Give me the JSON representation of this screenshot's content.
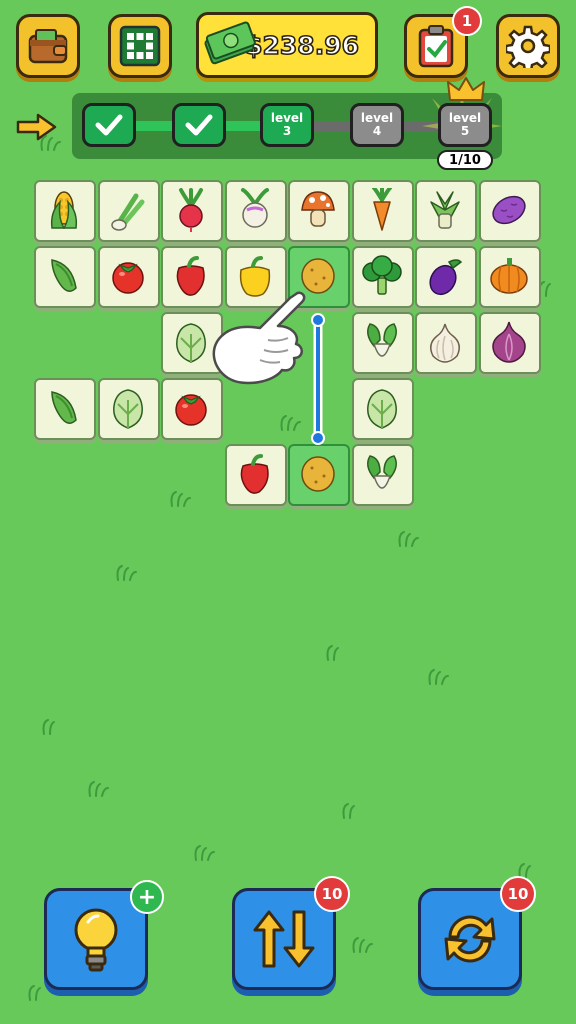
{
  "header": {
    "money": "$238.96",
    "task_badge": "1"
  },
  "progress": {
    "levels": [
      {
        "state": "done"
      },
      {
        "state": "done"
      },
      {
        "word": "level",
        "num": "3",
        "state": "current"
      },
      {
        "word": "level",
        "num": "4",
        "state": "locked"
      },
      {
        "word": "level",
        "num": "5",
        "state": "locked"
      }
    ],
    "counter": "1/10"
  },
  "board": {
    "tiles": [
      {
        "row": 0,
        "col": 0,
        "item": "corn"
      },
      {
        "row": 0,
        "col": 1,
        "item": "scallion"
      },
      {
        "row": 0,
        "col": 2,
        "item": "radish"
      },
      {
        "row": 0,
        "col": 3,
        "item": "turnip"
      },
      {
        "row": 0,
        "col": 4,
        "item": "mushroom"
      },
      {
        "row": 0,
        "col": 5,
        "item": "carrot"
      },
      {
        "row": 0,
        "col": 6,
        "item": "bamboo-shoot"
      },
      {
        "row": 0,
        "col": 7,
        "item": "sweet-potato"
      },
      {
        "row": 1,
        "col": 0,
        "item": "peas"
      },
      {
        "row": 1,
        "col": 1,
        "item": "tomato"
      },
      {
        "row": 1,
        "col": 2,
        "item": "red-pepper"
      },
      {
        "row": 1,
        "col": 3,
        "item": "yellow-pepper"
      },
      {
        "row": 1,
        "col": 4,
        "item": "potato",
        "selected": true
      },
      {
        "row": 1,
        "col": 5,
        "item": "broccoli"
      },
      {
        "row": 1,
        "col": 6,
        "item": "eggplant"
      },
      {
        "row": 1,
        "col": 7,
        "item": "pumpkin"
      },
      {
        "row": 2,
        "col": 2,
        "item": "cabbage"
      },
      {
        "row": 2,
        "col": 5,
        "item": "bok-choy"
      },
      {
        "row": 2,
        "col": 6,
        "item": "garlic"
      },
      {
        "row": 2,
        "col": 7,
        "item": "onion"
      },
      {
        "row": 3,
        "col": 0,
        "item": "peas"
      },
      {
        "row": 3,
        "col": 1,
        "item": "cabbage"
      },
      {
        "row": 3,
        "col": 2,
        "item": "tomato"
      },
      {
        "row": 3,
        "col": 5,
        "item": "cabbage"
      },
      {
        "row": 4,
        "col": 3,
        "item": "red-pepper"
      },
      {
        "row": 4,
        "col": 4,
        "item": "potato",
        "selected": true
      },
      {
        "row": 4,
        "col": 5,
        "item": "bok-choy"
      }
    ]
  },
  "tools": {
    "hint_badge": "+",
    "swap_badge": "10",
    "shuffle_badge": "10"
  },
  "colors": {
    "background": "#66c95a",
    "selected_tile": "#68d16b",
    "tool_button": "#2f90e8",
    "badge_red": "#e23b3b"
  }
}
